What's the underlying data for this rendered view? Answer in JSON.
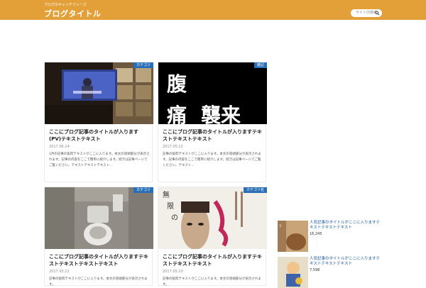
{
  "header": {
    "tagline": "ブログのキャッチフレーズ",
    "site_title": "ブログタイトル",
    "search_placeholder": "サイト内検索"
  },
  "posts": [
    {
      "badge": "カテゴリ",
      "title": "ここにブログ記事のタイトルが入ります(PV)テキストテキスト",
      "date": "2017.06.14",
      "excerpt": "1月の記事の抜粋テキストがここに入ります。本文の冒頭部分が表示されます。記事の内容をここで簡単に紹介します。続きは記事ページでご覧ください。テキストテキストテキスト…"
    },
    {
      "badge": "雑記",
      "title": "ここにブログ記事のタイトルが入りますテキストテキストテキスト",
      "date": "2017.05.13",
      "excerpt": "記事の抜粋テキストがここに入ります。本文の冒頭部分が表示されます。記事の内容をここで簡単に紹介します。続きは記事ページでご覧ください。テキスト…"
    },
    {
      "badge": "カテゴリ",
      "title": "ここにブログ記事のタイトルが入りますテキストテキストテキストテキスト",
      "date": "2017.05.12",
      "excerpt": "記事の抜粋テキストがここに入ります。本文の冒頭部分が表示されます。"
    },
    {
      "badge": "カテゴリ名",
      "title": "ここにブログ記事のタイトルが入りますテキストテキストテキスト",
      "date": "2017.05.10",
      "excerpt": "記事の抜粋テキストがここに入ります。本文の冒頭部分が表示されます。"
    }
  ],
  "thumbs": {
    "post2_text": [
      "腹",
      "痛",
      "襲来"
    ],
    "post4_text": [
      "無",
      "限",
      "の"
    ]
  },
  "sidebar": {
    "items": [
      {
        "title": "人気記事のタイトルがここに入りますテキストテキストテキスト",
        "count": "16,245"
      },
      {
        "title": "人気記事のタイトルがここに入りますテキストテキストテキスト",
        "count": "7,598"
      }
    ]
  },
  "colors": {
    "header": "#e3a038",
    "badge": "#2a6fb5",
    "link": "#1a5aa0"
  }
}
